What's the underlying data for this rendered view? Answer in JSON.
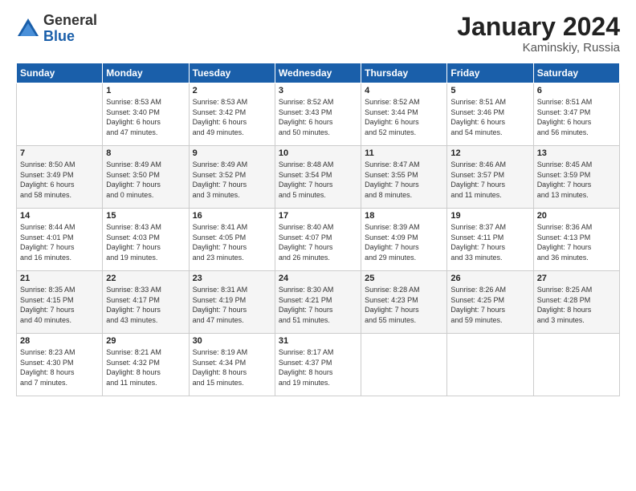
{
  "header": {
    "logo_general": "General",
    "logo_blue": "Blue",
    "month_title": "January 2024",
    "subtitle": "Kaminskiy, Russia"
  },
  "days_of_week": [
    "Sunday",
    "Monday",
    "Tuesday",
    "Wednesday",
    "Thursday",
    "Friday",
    "Saturday"
  ],
  "weeks": [
    [
      {
        "day": "",
        "lines": []
      },
      {
        "day": "1",
        "lines": [
          "Sunrise: 8:53 AM",
          "Sunset: 3:40 PM",
          "Daylight: 6 hours",
          "and 47 minutes."
        ]
      },
      {
        "day": "2",
        "lines": [
          "Sunrise: 8:53 AM",
          "Sunset: 3:42 PM",
          "Daylight: 6 hours",
          "and 49 minutes."
        ]
      },
      {
        "day": "3",
        "lines": [
          "Sunrise: 8:52 AM",
          "Sunset: 3:43 PM",
          "Daylight: 6 hours",
          "and 50 minutes."
        ]
      },
      {
        "day": "4",
        "lines": [
          "Sunrise: 8:52 AM",
          "Sunset: 3:44 PM",
          "Daylight: 6 hours",
          "and 52 minutes."
        ]
      },
      {
        "day": "5",
        "lines": [
          "Sunrise: 8:51 AM",
          "Sunset: 3:46 PM",
          "Daylight: 6 hours",
          "and 54 minutes."
        ]
      },
      {
        "day": "6",
        "lines": [
          "Sunrise: 8:51 AM",
          "Sunset: 3:47 PM",
          "Daylight: 6 hours",
          "and 56 minutes."
        ]
      }
    ],
    [
      {
        "day": "7",
        "lines": [
          "Sunrise: 8:50 AM",
          "Sunset: 3:49 PM",
          "Daylight: 6 hours",
          "and 58 minutes."
        ]
      },
      {
        "day": "8",
        "lines": [
          "Sunrise: 8:49 AM",
          "Sunset: 3:50 PM",
          "Daylight: 7 hours",
          "and 0 minutes."
        ]
      },
      {
        "day": "9",
        "lines": [
          "Sunrise: 8:49 AM",
          "Sunset: 3:52 PM",
          "Daylight: 7 hours",
          "and 3 minutes."
        ]
      },
      {
        "day": "10",
        "lines": [
          "Sunrise: 8:48 AM",
          "Sunset: 3:54 PM",
          "Daylight: 7 hours",
          "and 5 minutes."
        ]
      },
      {
        "day": "11",
        "lines": [
          "Sunrise: 8:47 AM",
          "Sunset: 3:55 PM",
          "Daylight: 7 hours",
          "and 8 minutes."
        ]
      },
      {
        "day": "12",
        "lines": [
          "Sunrise: 8:46 AM",
          "Sunset: 3:57 PM",
          "Daylight: 7 hours",
          "and 11 minutes."
        ]
      },
      {
        "day": "13",
        "lines": [
          "Sunrise: 8:45 AM",
          "Sunset: 3:59 PM",
          "Daylight: 7 hours",
          "and 13 minutes."
        ]
      }
    ],
    [
      {
        "day": "14",
        "lines": [
          "Sunrise: 8:44 AM",
          "Sunset: 4:01 PM",
          "Daylight: 7 hours",
          "and 16 minutes."
        ]
      },
      {
        "day": "15",
        "lines": [
          "Sunrise: 8:43 AM",
          "Sunset: 4:03 PM",
          "Daylight: 7 hours",
          "and 19 minutes."
        ]
      },
      {
        "day": "16",
        "lines": [
          "Sunrise: 8:41 AM",
          "Sunset: 4:05 PM",
          "Daylight: 7 hours",
          "and 23 minutes."
        ]
      },
      {
        "day": "17",
        "lines": [
          "Sunrise: 8:40 AM",
          "Sunset: 4:07 PM",
          "Daylight: 7 hours",
          "and 26 minutes."
        ]
      },
      {
        "day": "18",
        "lines": [
          "Sunrise: 8:39 AM",
          "Sunset: 4:09 PM",
          "Daylight: 7 hours",
          "and 29 minutes."
        ]
      },
      {
        "day": "19",
        "lines": [
          "Sunrise: 8:37 AM",
          "Sunset: 4:11 PM",
          "Daylight: 7 hours",
          "and 33 minutes."
        ]
      },
      {
        "day": "20",
        "lines": [
          "Sunrise: 8:36 AM",
          "Sunset: 4:13 PM",
          "Daylight: 7 hours",
          "and 36 minutes."
        ]
      }
    ],
    [
      {
        "day": "21",
        "lines": [
          "Sunrise: 8:35 AM",
          "Sunset: 4:15 PM",
          "Daylight: 7 hours",
          "and 40 minutes."
        ]
      },
      {
        "day": "22",
        "lines": [
          "Sunrise: 8:33 AM",
          "Sunset: 4:17 PM",
          "Daylight: 7 hours",
          "and 43 minutes."
        ]
      },
      {
        "day": "23",
        "lines": [
          "Sunrise: 8:31 AM",
          "Sunset: 4:19 PM",
          "Daylight: 7 hours",
          "and 47 minutes."
        ]
      },
      {
        "day": "24",
        "lines": [
          "Sunrise: 8:30 AM",
          "Sunset: 4:21 PM",
          "Daylight: 7 hours",
          "and 51 minutes."
        ]
      },
      {
        "day": "25",
        "lines": [
          "Sunrise: 8:28 AM",
          "Sunset: 4:23 PM",
          "Daylight: 7 hours",
          "and 55 minutes."
        ]
      },
      {
        "day": "26",
        "lines": [
          "Sunrise: 8:26 AM",
          "Sunset: 4:25 PM",
          "Daylight: 7 hours",
          "and 59 minutes."
        ]
      },
      {
        "day": "27",
        "lines": [
          "Sunrise: 8:25 AM",
          "Sunset: 4:28 PM",
          "Daylight: 8 hours",
          "and 3 minutes."
        ]
      }
    ],
    [
      {
        "day": "28",
        "lines": [
          "Sunrise: 8:23 AM",
          "Sunset: 4:30 PM",
          "Daylight: 8 hours",
          "and 7 minutes."
        ]
      },
      {
        "day": "29",
        "lines": [
          "Sunrise: 8:21 AM",
          "Sunset: 4:32 PM",
          "Daylight: 8 hours",
          "and 11 minutes."
        ]
      },
      {
        "day": "30",
        "lines": [
          "Sunrise: 8:19 AM",
          "Sunset: 4:34 PM",
          "Daylight: 8 hours",
          "and 15 minutes."
        ]
      },
      {
        "day": "31",
        "lines": [
          "Sunrise: 8:17 AM",
          "Sunset: 4:37 PM",
          "Daylight: 8 hours",
          "and 19 minutes."
        ]
      },
      {
        "day": "",
        "lines": []
      },
      {
        "day": "",
        "lines": []
      },
      {
        "day": "",
        "lines": []
      }
    ]
  ]
}
